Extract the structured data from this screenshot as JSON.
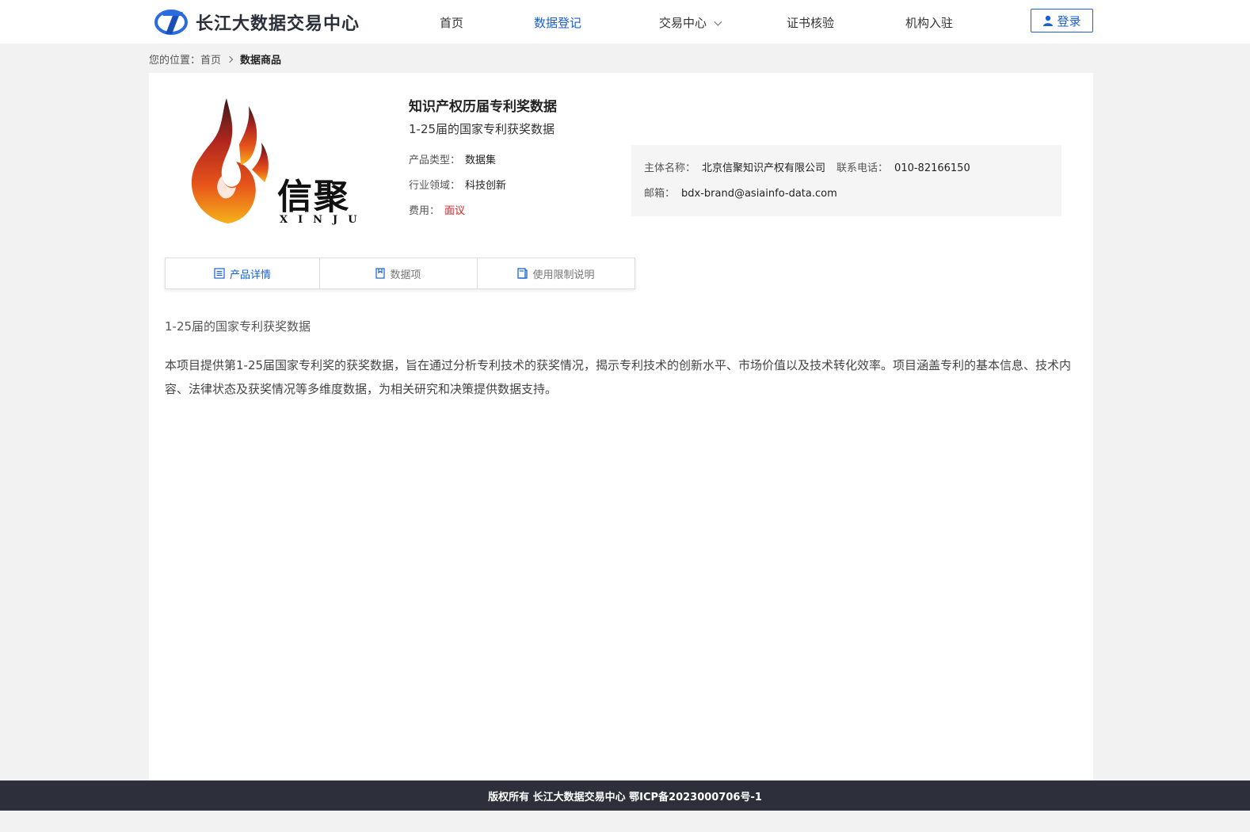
{
  "header": {
    "site_name": "长江大数据交易中心",
    "nav": [
      {
        "label": "首页"
      },
      {
        "label": "数据登记"
      },
      {
        "label": "交易中心"
      },
      {
        "label": "证书核验"
      },
      {
        "label": "机构入驻"
      }
    ],
    "login_label": "登录",
    "accent_color": "#1a5fd3"
  },
  "breadcrumb": {
    "prefix": "您的位置：",
    "home": "首页",
    "current": "数据商品"
  },
  "product": {
    "brand_chinese": "信聚",
    "brand_latin": "XINJU",
    "title": "知识产权历届专利奖数据",
    "subtitle": "1-25届的国家专利获奖数据",
    "type_label": "产品类型：",
    "type_value": "数据集",
    "industry_label": "行业领域：",
    "industry_value": "科技创新",
    "fee_label": "费用：",
    "fee_value": "面议"
  },
  "contact": {
    "entity_label": "主体名称：",
    "entity_value": "北京信聚知识产权有限公司",
    "phone_label": "联系电话：",
    "phone_value": "010-82166150",
    "email_label": "邮箱：",
    "email_value": "bdx-brand@asiainfo-data.com"
  },
  "tabs": [
    {
      "label": "产品详情",
      "icon": "list-icon"
    },
    {
      "label": "数据项",
      "icon": "bookmark-icon"
    },
    {
      "label": "使用限制说明",
      "icon": "book-icon"
    }
  ],
  "description": {
    "title": "1-25届的国家专利获奖数据",
    "body": "本项目提供第1-25届国家专利奖的获奖数据，旨在通过分析专利技术的获奖情况，揭示专利技术的创新水平、市场价值以及技术转化效率。项目涵盖专利的基本信息、技术内容、法律状态及获奖情况等多维度数据，为相关研究和决策提供数据支持。"
  },
  "footer": {
    "text": "版权所有 长江大数据交易中心 鄂ICP备2023000706号-1"
  }
}
